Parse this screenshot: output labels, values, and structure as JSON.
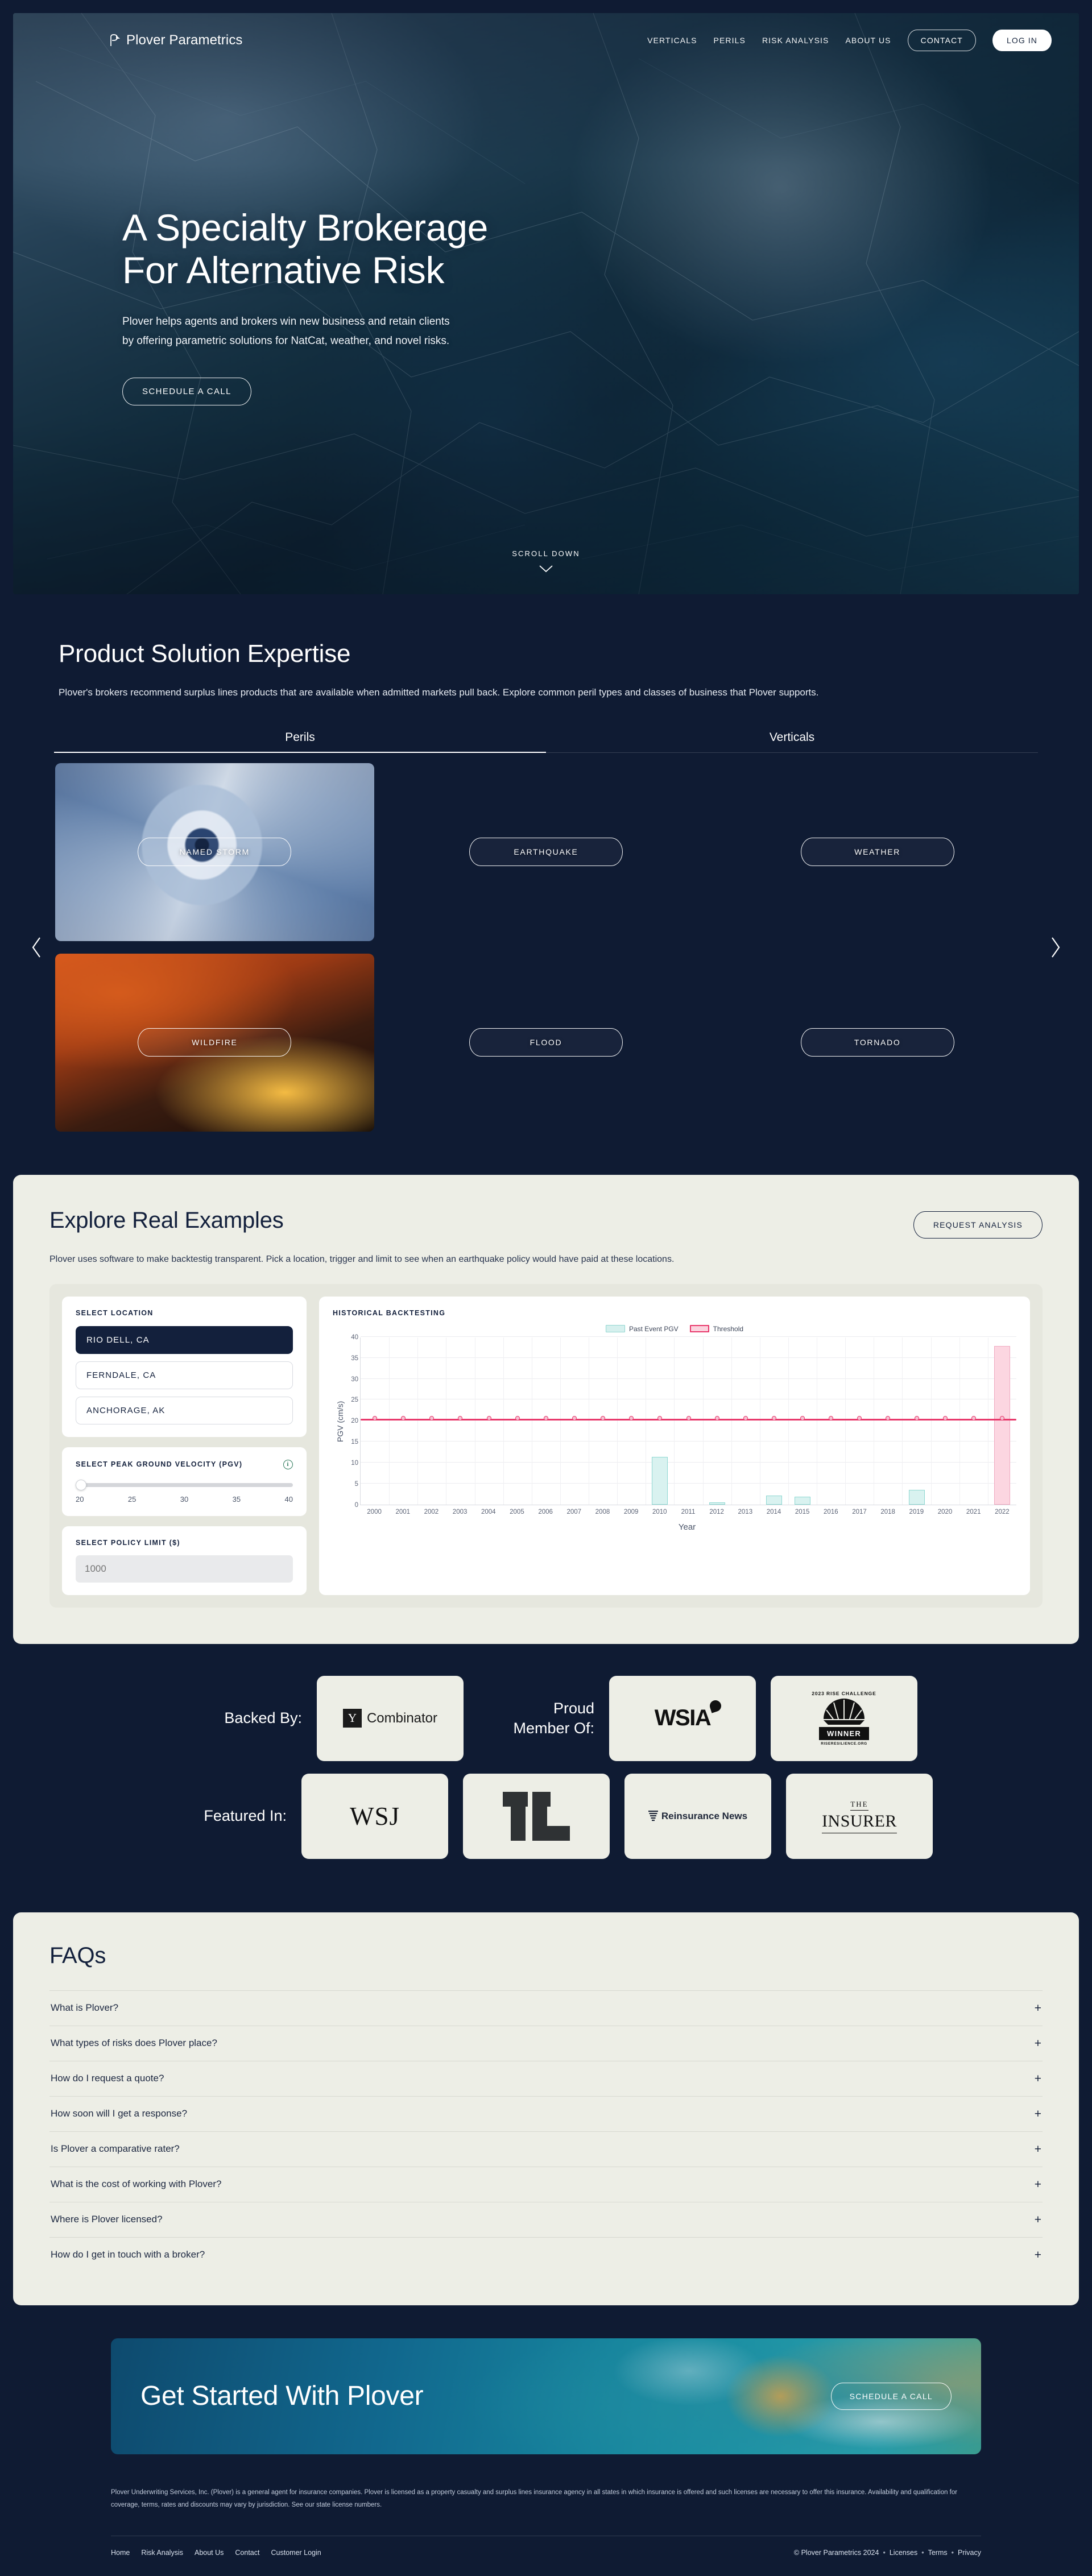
{
  "brand": {
    "name": "Plover Parametrics",
    "logo_icon": "plover-bird-logo"
  },
  "nav": {
    "links": [
      {
        "label": "VERTICALS"
      },
      {
        "label": "PERILS"
      },
      {
        "label": "RISK ANALYSIS"
      },
      {
        "label": "ABOUT US"
      }
    ],
    "contact_label": "CONTACT",
    "login_label": "LOG IN"
  },
  "hero": {
    "title_line1": "A Specialty Brokerage",
    "title_line2": "For Alternative Risk",
    "subtitle": "Plover helps agents and brokers win new business and retain clients by offering parametric solutions for NatCat, weather, and novel risks.",
    "cta_label": "SCHEDULE A CALL",
    "scroll_label": "SCROLL DOWN"
  },
  "products": {
    "heading": "Product Solution Expertise",
    "lead": "Plover's brokers recommend surplus lines products that are available when admitted markets pull back. Explore common peril types and classes of business that Plover supports.",
    "tabs": [
      {
        "label": "Perils",
        "active": true
      },
      {
        "label": "Verticals",
        "active": false
      }
    ],
    "cards": [
      {
        "label": "NAMED STORM",
        "image": "hurricane-satellite"
      },
      {
        "label": "EARTHQUAKE",
        "image": "cracked-boardwalk"
      },
      {
        "label": "WEATHER",
        "image": "storm-debris-road"
      },
      {
        "label": "WILDFIRE",
        "image": "wildfire-ridge"
      },
      {
        "label": "FLOOD",
        "image": "flooded-street-cars"
      },
      {
        "label": "TORNADO",
        "image": "tornado-funnel"
      }
    ],
    "prev_icon": "chevron-left-icon",
    "next_icon": "chevron-right-icon"
  },
  "explore": {
    "title": "Explore Real Examples",
    "request_label": "REQUEST ANALYSIS",
    "lead": "Plover uses software to make backtestig transparent. Pick a location, trigger and limit to see when an earthquake policy would have paid at these locations.",
    "location_label": "SELECT LOCATION",
    "locations": [
      {
        "label": "RIO DELL, CA",
        "selected": true
      },
      {
        "label": "FERNDALE, CA",
        "selected": false
      },
      {
        "label": "ANCHORAGE, AK",
        "selected": false
      }
    ],
    "pgv_label": "SELECT PEAK GROUND VELOCITY (PGV)",
    "pgv_info_icon": "info-icon",
    "pgv_ticks": [
      "20",
      "25",
      "30",
      "35",
      "40"
    ],
    "pgv_value": "20",
    "limit_label": "SELECT POLICY LIMIT ($)",
    "limit_placeholder": "1000",
    "chart_heading": "HISTORICAL BACKTESTING"
  },
  "chart_data": {
    "type": "bar",
    "title": "HISTORICAL BACKTESTING",
    "xlabel": "Year",
    "ylabel": "PGV (cm/s)",
    "ylim": [
      0,
      40
    ],
    "yticks": [
      0,
      5,
      10,
      15,
      20,
      25,
      30,
      35,
      40
    ],
    "grid": true,
    "legend_position": "top-center",
    "categories": [
      "2000",
      "2001",
      "2002",
      "2003",
      "2004",
      "2005",
      "2006",
      "2007",
      "2008",
      "2009",
      "2010",
      "2011",
      "2012",
      "2013",
      "2014",
      "2015",
      "2016",
      "2017",
      "2018",
      "2019",
      "2020",
      "2021",
      "2022"
    ],
    "series": [
      {
        "name": "Past Event PGV",
        "color": "#8fd8d2",
        "fill": "#d9f2f0",
        "values": [
          0,
          0,
          0,
          0,
          0,
          0,
          0,
          0,
          0,
          0,
          11.4,
          0,
          0.5,
          0,
          2.1,
          1.8,
          0,
          0,
          0,
          3.5,
          0,
          0,
          37.8
        ]
      },
      {
        "name": "Threshold",
        "color": "#e8396c",
        "fill": "#fbd3de",
        "type": "line",
        "values": [
          20,
          20,
          20,
          20,
          20,
          20,
          20,
          20,
          20,
          20,
          20,
          20,
          20,
          20,
          20,
          20,
          20,
          20,
          20,
          20,
          20,
          20,
          20
        ]
      }
    ],
    "exceeded_years": [
      "2022"
    ]
  },
  "partners": {
    "rows": [
      {
        "label": "Backed By:",
        "logos": [
          {
            "name": "y-combinator",
            "text": "Combinator",
            "mark": "Y"
          }
        ]
      },
      {
        "label": "Proud\nMember Of:",
        "logos": [
          {
            "name": "wsia",
            "text": "WSIA"
          },
          {
            "name": "rise-challenge-winner",
            "arc": "2023 RISE CHALLENGE",
            "badge": "WINNER",
            "url": "RISERESILIENCE.ORG"
          }
        ]
      },
      {
        "label": "Featured In:",
        "logos": [
          {
            "name": "wall-street-journal",
            "text": "WSJ"
          },
          {
            "name": "techcrunch",
            "text": "TC"
          },
          {
            "name": "reinsurance-news",
            "text": "Reinsurance News"
          },
          {
            "name": "the-insurer",
            "text_top": "THE",
            "text_main": "INSURER"
          }
        ]
      }
    ]
  },
  "faqs": {
    "title": "FAQs",
    "items": [
      {
        "q": "What is Plover?"
      },
      {
        "q": "What types of risks does Plover place?"
      },
      {
        "q": "How do I request a quote?"
      },
      {
        "q": "How soon will I get a response?"
      },
      {
        "q": "Is Plover a comparative rater?"
      },
      {
        "q": "What is the cost of working with Plover?"
      },
      {
        "q": "Where is Plover licensed?"
      },
      {
        "q": "How do I get in touch with a broker?"
      }
    ],
    "expand_icon": "plus-icon"
  },
  "cta": {
    "title": "Get Started With Plover",
    "button": "SCHEDULE A CALL"
  },
  "footer": {
    "disclaimer": "Plover Underwriting Services, Inc. (Plover) is a general agent for insurance companies. Plover is licensed as a property casualty and surplus lines insurance agency in all states in which insurance is offered and such licenses are necessary to offer this insurance. Availability and qualification for coverage, terms, rates and discounts may vary by jurisdiction. See our state license numbers.",
    "links": [
      {
        "label": "Home"
      },
      {
        "label": "Risk Analysis"
      },
      {
        "label": "About Us"
      },
      {
        "label": "Contact"
      },
      {
        "label": "Customer Login"
      }
    ],
    "copyright": "© Plover Parametrics 2024",
    "legal_links": [
      {
        "label": "Licenses"
      },
      {
        "label": "Terms"
      },
      {
        "label": "Privacy"
      }
    ]
  },
  "colors": {
    "page_bg": "#0f1b33",
    "panel_cream": "#edeee6",
    "navy": "#13203c",
    "accent_pink": "#e8396c",
    "accent_teal": "#8fd8d2"
  }
}
